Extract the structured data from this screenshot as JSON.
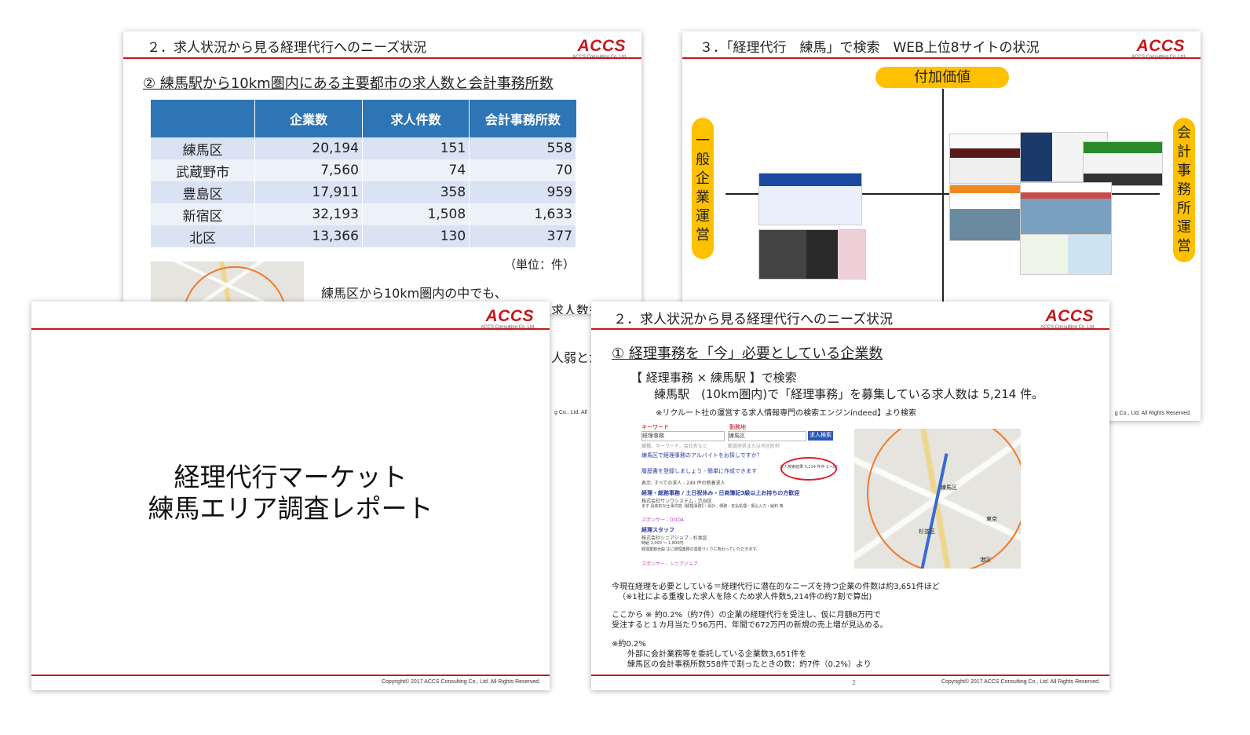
{
  "brand": {
    "logo": "ACCS",
    "logo_sub": "ACCS Consulting Co.,Ltd",
    "red": "#c8161d",
    "blue": "#2e75b6",
    "yellow": "#ffc000"
  },
  "slide_table": {
    "header": "２．求人状況から見る経理代行へのニーズ状況",
    "subtitle": "② 練馬駅から10km圏内にある主要都市の求人数と会計事務所数",
    "columns": [
      "",
      "企業数",
      "求人件数",
      "会計事務所数"
    ],
    "rows": [
      [
        "練馬区",
        "20,194",
        "151",
        "558"
      ],
      [
        "武蔵野市",
        "7,560",
        "74",
        "70"
      ],
      [
        "豊島区",
        "17,911",
        "358",
        "959"
      ],
      [
        "新宿区",
        "32,193",
        "1,508",
        "1,633"
      ],
      [
        "北区",
        "13,366",
        "130",
        "377"
      ]
    ],
    "unit": "（単位：件）",
    "note": "練馬区から10km圏内の中でも、",
    "note_cut1": "求人数も",
    "note_cut2": "人弱とか"
  },
  "slide_quadrant": {
    "header": "３．「経理代行　練馬」で検索　WEB上位8サイトの状況",
    "top_label": "付加価値",
    "left_label": [
      "一",
      "般",
      "企",
      "業",
      "運",
      "営"
    ],
    "right_label": [
      "会",
      "計",
      "事",
      "務",
      "所",
      "運",
      "営"
    ]
  },
  "slide_title": {
    "line1": "経理代行マーケット",
    "line2": "練馬エリア調査レポート",
    "copyright": "Copyright© 2017  ACCS Consulting Co., Ltd. All Rights Reserved."
  },
  "slide_needs": {
    "header": "２．求人状況から見る経理代行へのニーズ状況",
    "subtitle": "① 経理事務を「今」必要としている企業数",
    "search_line": "【 経理事務 × 練馬駅 】で検索",
    "result_line": "練馬駅　(10km圏内)で「経理事務」を募集している求人数は 5,214 件。",
    "source": "※リクルート社の運営する求人情報専門の検索エンジンindeed】より検索",
    "p1a": "今現在経理を必要としている＝経理代行に潜在的なニーズを持つ企業の件数は約3,651件ほど",
    "p1b": "（※1社による重複した求人を除くため求人件数5,214件の約7割で算出)",
    "p2a": "ここから ※ 約0.2%（約7件）の企業の経理代行を受注し、仮に月額8万円で",
    "p2b": "受注すると１カ月当たり56万円、年間で672万円の新規の売上増が見込める。",
    "p3a": "※約0.2%",
    "p3b": "外部に会計業務等を委託している企業数3,651件を",
    "p3c": "練馬区の会計事務所数558件で割ったときの数：約7件（0.2%）より",
    "page_no": "2",
    "copyright": "Copyright© 2017  ACCS Consulting Co., Ltd. All Rights Reserved.",
    "mock": {
      "keyword_label": "キーワード",
      "keyword": "経理事務",
      "location_label": "勤務地",
      "location": "練馬区",
      "button": "求人検索",
      "hint1": "職種、キーワード、会社名など",
      "hint2": "都道府県または市区町村",
      "count": "求人検索結果 5,214 件中 1～10",
      "link1": "練馬区で経理事務のアルバイトをお探しですか？",
      "link2": "履歴書を登録しましょう - 簡単に作成できます",
      "filter": "表示: すべての求人 - 249 件の新着求人",
      "job1": "経理・総務事務 / 土日祝休み・日商簿記3級以上お持ちの方歓迎",
      "job1_company": "株式会社サンワシステム - 渋谷区",
      "job1_desc": "ます 具体的な仕事内容【経理事務】・会計、債務・支払処理・振込入力・給料 等",
      "job1_sponsor": "スポンサー - DODA",
      "job2": "経理スタッフ",
      "job2_company": "株式会社シニアジョブ - 杉並区",
      "job2_pay": "時給 1,000 ～ 1,800円",
      "job2_desc": "経理業務全般 主に経理業務の基盤づくりに携わっていただきます。",
      "job2_sponsor": "スポンサー - シニアジョブ"
    },
    "map_labels": [
      "練馬区",
      "杉並区",
      "東京",
      "港区"
    ]
  },
  "copyright_right": "g Co., Ltd. All Rights Reserved.",
  "copyright_tl": "g Co., Ltd. All"
}
